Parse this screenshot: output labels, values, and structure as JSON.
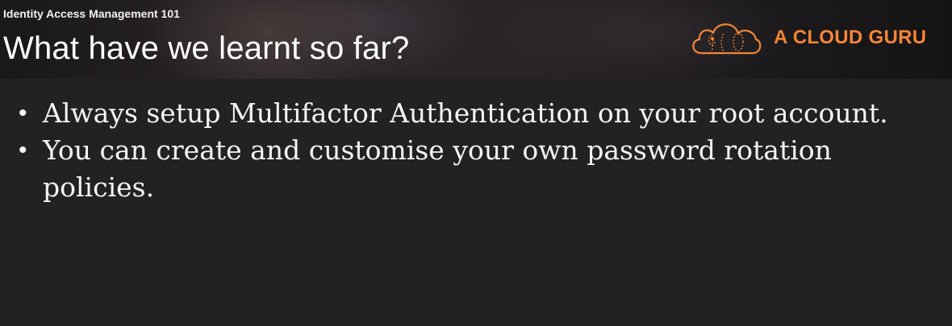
{
  "header": {
    "course_title": "Identity Access Management 101",
    "slide_title": "What have we learnt so far?"
  },
  "logo": {
    "text": "A CLOUD GURU",
    "icon": "cloud-icon",
    "color": "#f58536"
  },
  "bullets": [
    {
      "text": "Always setup Multifactor Authentication on your root account."
    },
    {
      "text": "You can create and customise your own password rotation policies."
    }
  ]
}
